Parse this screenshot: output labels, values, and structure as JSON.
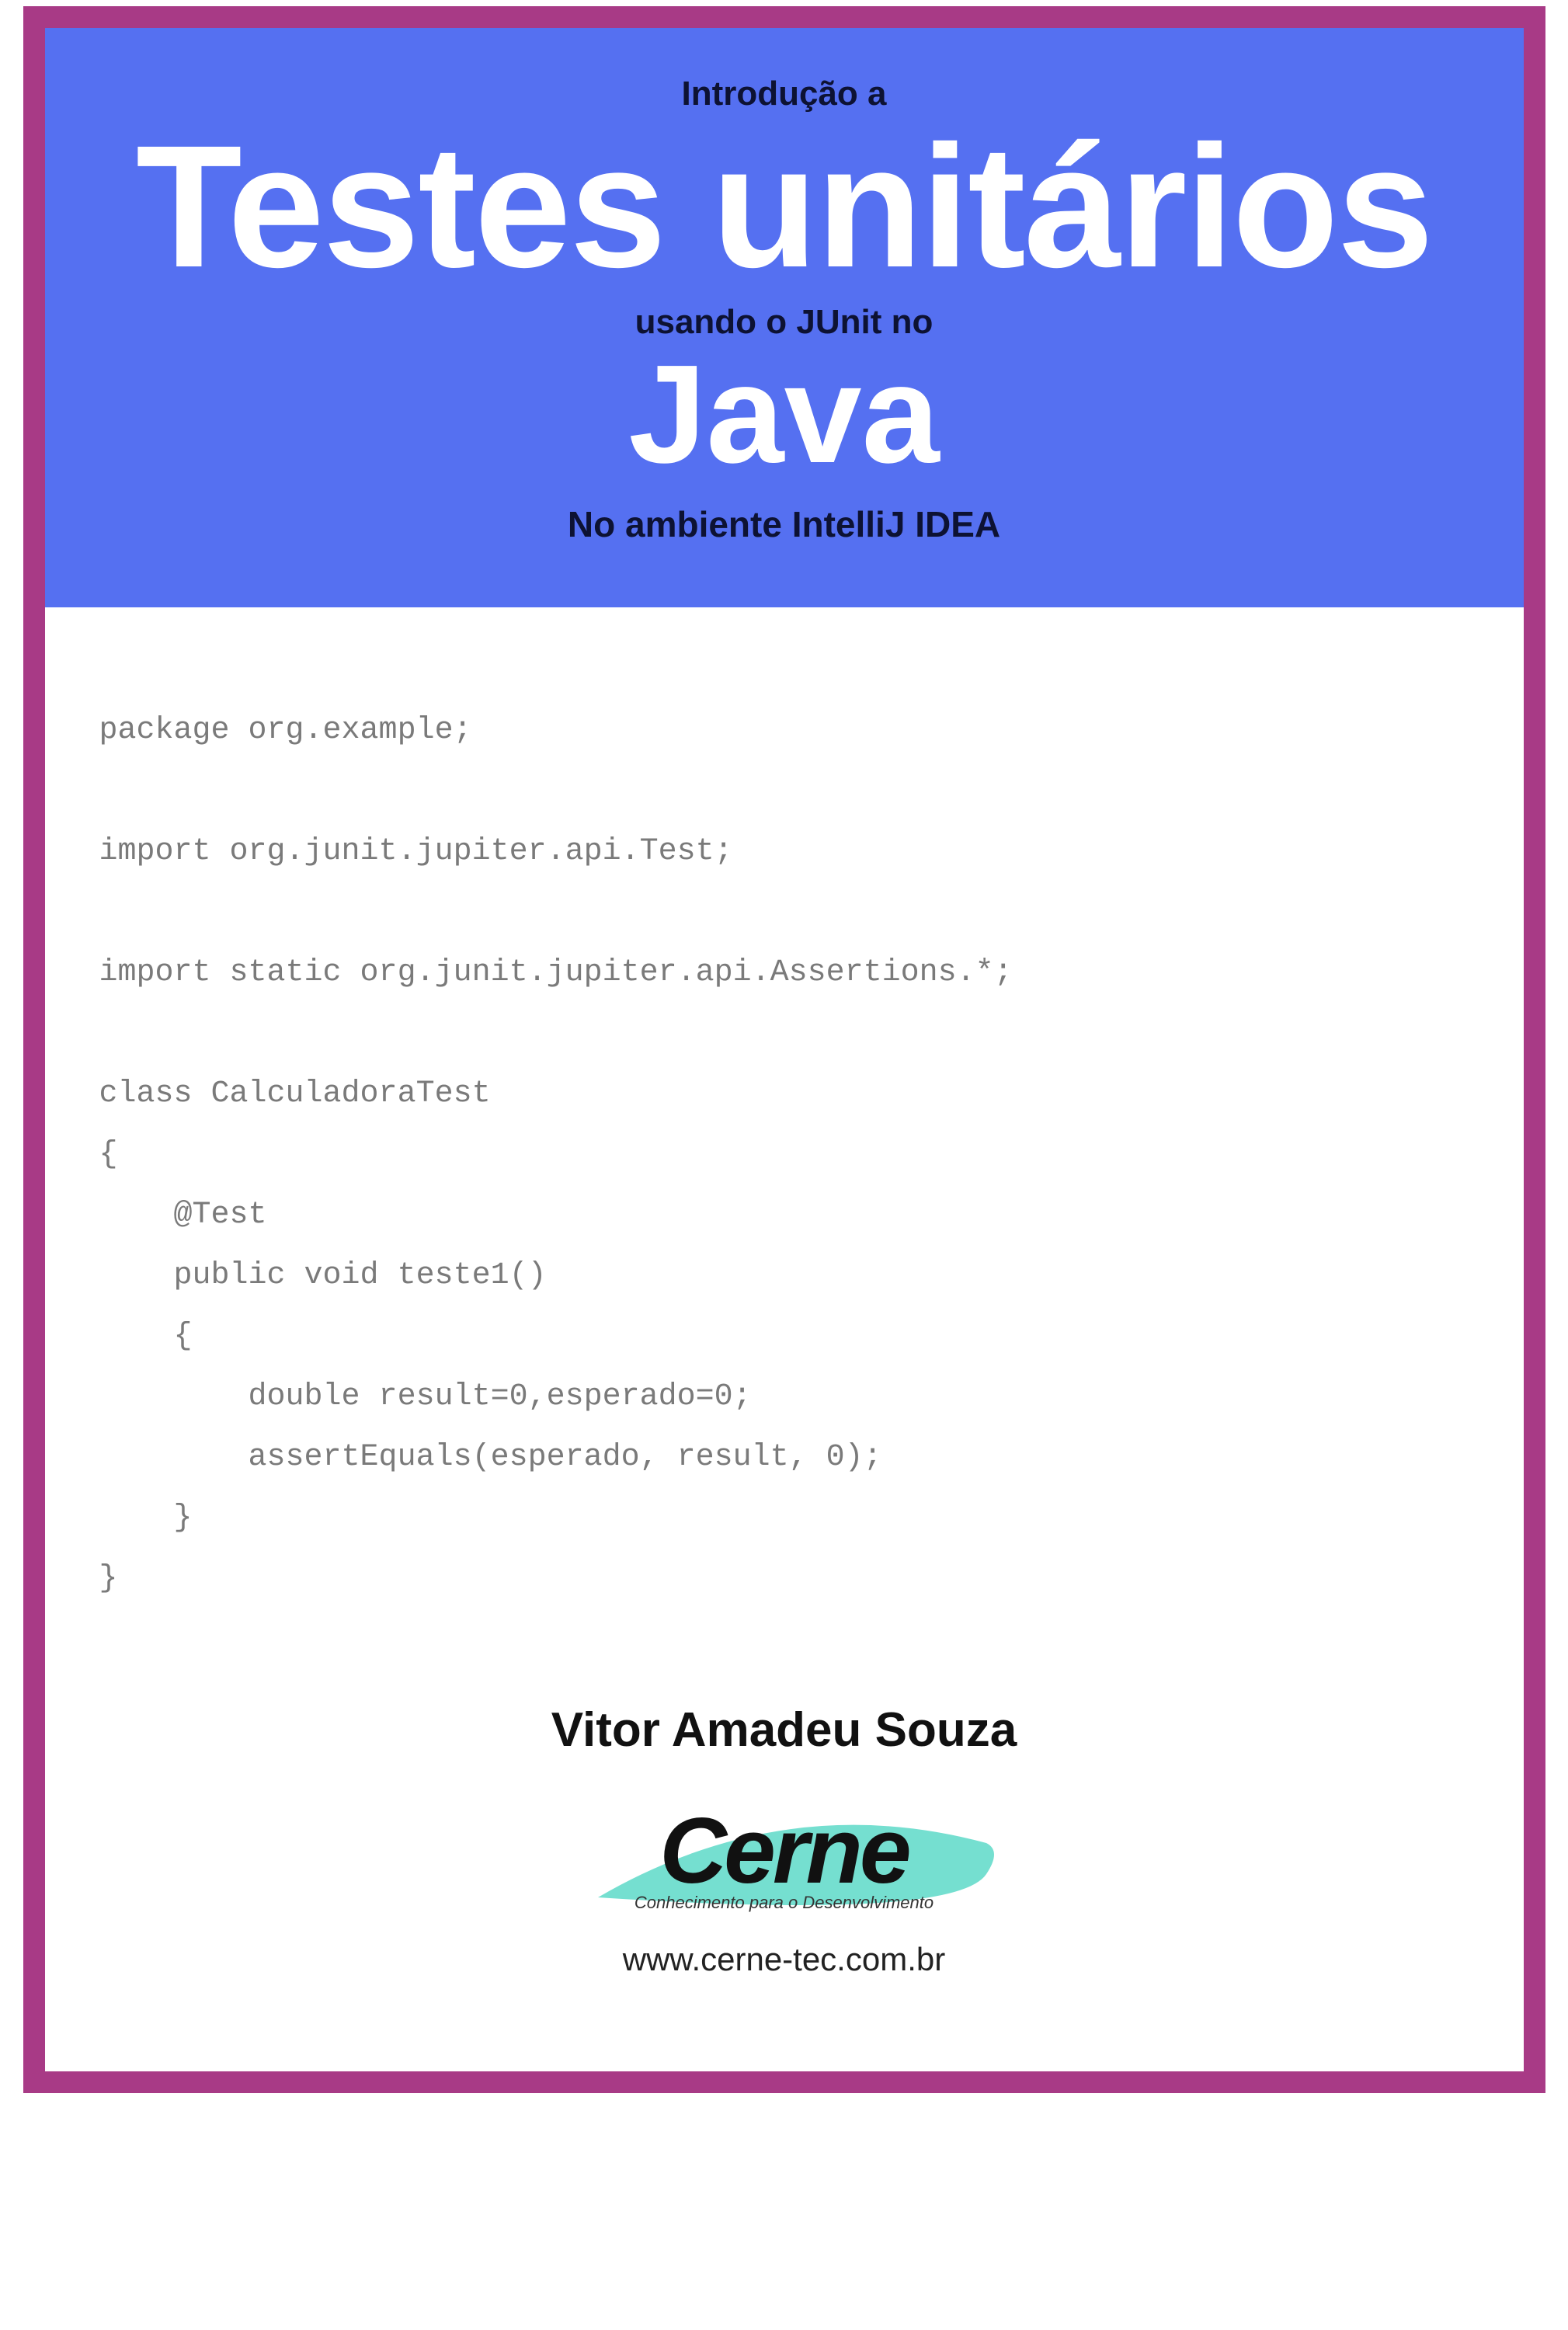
{
  "header": {
    "sup1": "Introdução a",
    "title1": "Testes unitários",
    "sup2": "usando o JUnit no",
    "title2": "Java",
    "sup3": "No ambiente IntelliJ IDEA"
  },
  "code": "package org.example;\n\nimport org.junit.jupiter.api.Test;\n\nimport static org.junit.jupiter.api.Assertions.*;\n\nclass CalculadoraTest\n{\n    @Test\n    public void teste1()\n    {\n        double result=0,esperado=0;\n        assertEquals(esperado, result, 0);\n    }\n}",
  "footer": {
    "author": "Vitor Amadeu Souza",
    "logo_name": "Cerne",
    "logo_tag": "Conhecimento para o Desenvolvimento",
    "url": "www.cerne-tec.com.br"
  }
}
